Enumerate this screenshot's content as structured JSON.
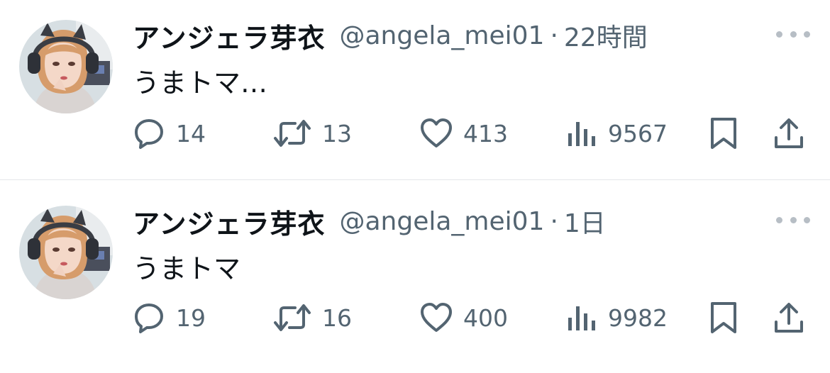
{
  "tweets": [
    {
      "display_name": "アンジェラ芽衣",
      "handle": "@angela_mei01",
      "separator": "·",
      "time": "22時間",
      "text": "うまトマ…",
      "replies": "14",
      "retweets": "13",
      "likes": "413",
      "views": "9567"
    },
    {
      "display_name": "アンジェラ芽衣",
      "handle": "@angela_mei01",
      "separator": "·",
      "time": "1日",
      "text": "うまトマ",
      "replies": "19",
      "retweets": "16",
      "likes": "400",
      "views": "9982"
    }
  ],
  "icons": {
    "more": "more-dots-icon",
    "reply": "reply-bubble-icon",
    "retweet": "retweet-arrows-icon",
    "like": "heart-icon",
    "views": "bar-chart-icon",
    "bookmark": "bookmark-icon",
    "share": "share-upload-icon"
  },
  "colors": {
    "text_primary": "#0f1419",
    "text_secondary": "#536471",
    "divider": "#e4e7ea",
    "more_dots": "#b7bec5"
  }
}
